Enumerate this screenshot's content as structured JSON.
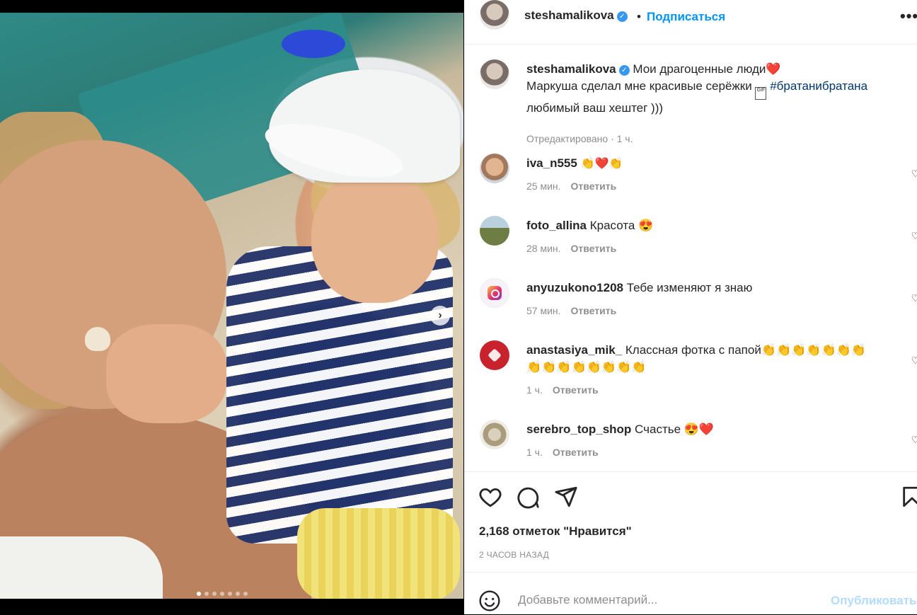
{
  "post": {
    "author": "steshamalikova",
    "follow_label": "Подписаться",
    "dot": "•",
    "more": "•••",
    "caption_line1": "Мои драгоценные люди",
    "caption_line2_pre": "Маркуша сделал мне красивые серёжки",
    "caption_hashtag": "#братанибратана",
    "caption_line3": "любимый ваш хештег )))",
    "edited_label": "Отредактировано · 1 ч.",
    "photo_count": 7,
    "photo_active": 1
  },
  "comments": [
    {
      "user": "iva_n555",
      "text": "👏❤️👏",
      "time": "25 мин.",
      "reply": "Ответить"
    },
    {
      "user": "foto_allina",
      "text": "Красота 😍",
      "time": "28 мин.",
      "reply": "Ответить"
    },
    {
      "user": "anyuzukono1208",
      "text": "Тебе изменяют я знаю",
      "time": "57 мин.",
      "reply": "Ответить"
    },
    {
      "user": "anastasiya_mik_",
      "text": "Классная фотка с папой👏👏👏👏👏👏👏",
      "text2": "👏👏👏👏👏👏👏👏",
      "time": "1 ч.",
      "reply": "Ответить"
    },
    {
      "user": "serebro_top_shop",
      "text": "Счастье 😍❤️",
      "time": "1 ч.",
      "reply": "Ответить"
    }
  ],
  "stats": {
    "likes": "2,168 отметок \"Нравится\"",
    "posted": "2 ЧАСОВ НАЗАД"
  },
  "add_comment": {
    "placeholder": "Добавьте комментарий...",
    "publish": "Опубликовать"
  },
  "icons": [
    "heart-icon",
    "comment-icon",
    "share-icon",
    "bookmark-icon",
    "emoji-icon",
    "next-arrow-icon",
    "verified-icon",
    "more-icon"
  ]
}
